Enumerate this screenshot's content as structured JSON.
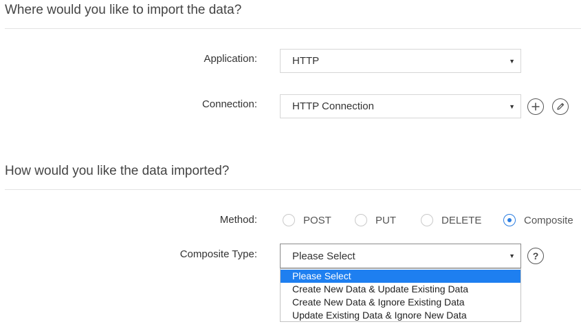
{
  "sections": {
    "destination_title": "Where would you like to import the data?",
    "method_title": "How would you like the data imported?"
  },
  "application": {
    "label": "Application:",
    "value": "HTTP"
  },
  "connection": {
    "label": "Connection:",
    "value": "HTTP Connection"
  },
  "method": {
    "label": "Method:",
    "options": [
      "POST",
      "PUT",
      "DELETE",
      "Composite"
    ],
    "selected": "Composite"
  },
  "composite_type": {
    "label": "Composite Type:",
    "value": "Please Select",
    "options": [
      "Please Select",
      "Create New Data & Update Existing Data",
      "Create New Data & Ignore Existing Data",
      "Update Existing Data & Ignore New Data"
    ],
    "highlighted_index": 0
  },
  "icons": {
    "dropdown_arrow": "▼",
    "add": "plus-circle-icon",
    "edit": "pencil-circle-icon",
    "help": "?"
  },
  "colors": {
    "accent": "#2a7de1",
    "highlight": "#1e7ff0"
  }
}
